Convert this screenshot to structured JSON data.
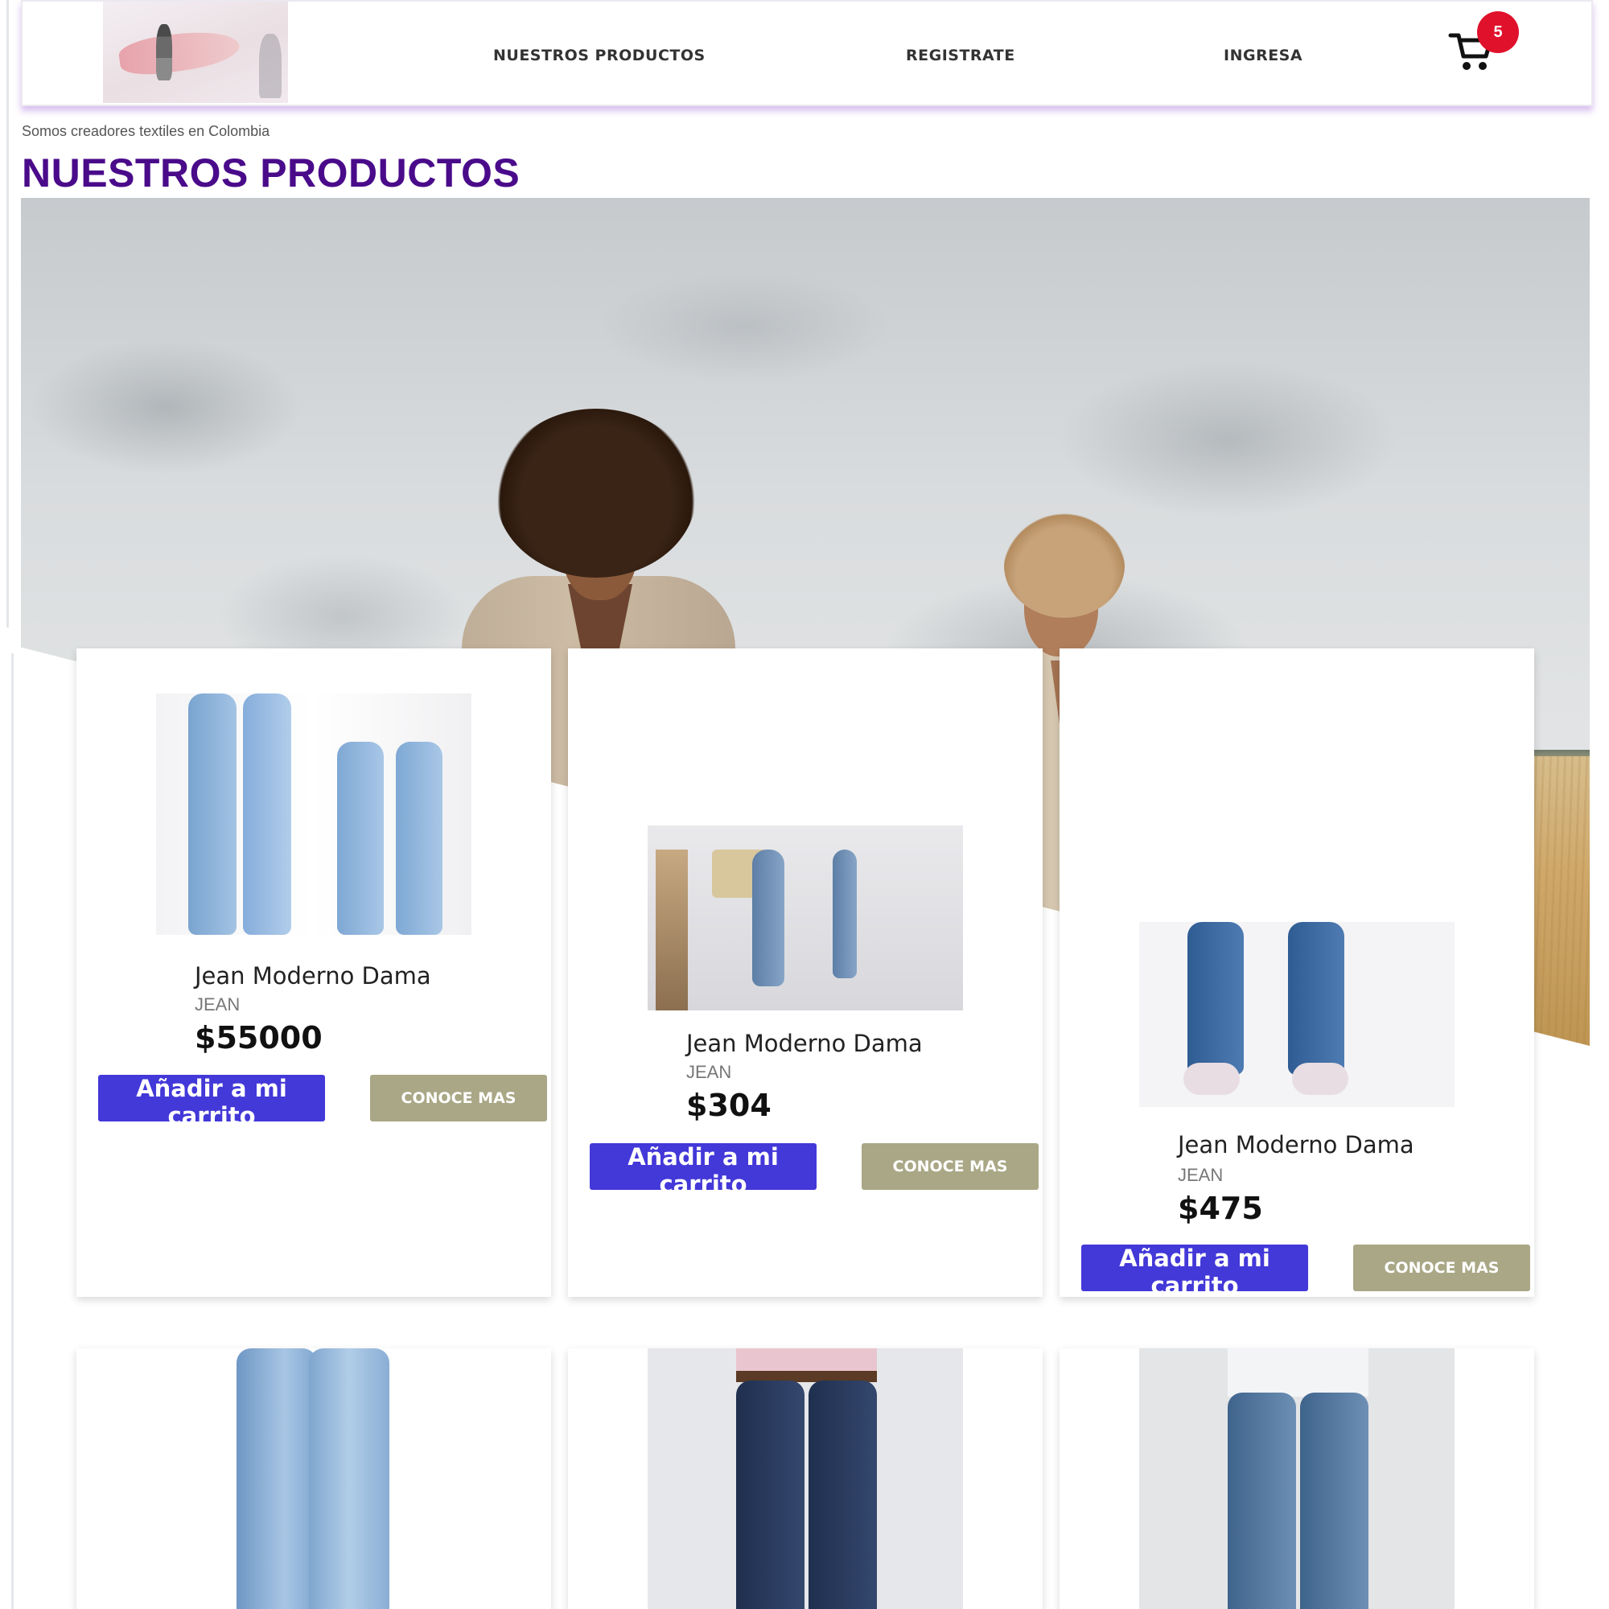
{
  "header": {
    "nav": [
      {
        "label": "NUESTROS PRODUCTOS"
      },
      {
        "label": "REGISTRATE"
      },
      {
        "label": "INGRESA"
      }
    ],
    "cart_count": "5",
    "logo_icon": "mannequin-logo"
  },
  "intro": {
    "tagline": "Somos creadores textiles en Colombia",
    "title": "NUESTROS PRODUCTOS"
  },
  "products": [
    {
      "name": "Jean Moderno Dama",
      "category": "JEAN",
      "price": "$55000",
      "add_label": "Añadir a mi carrito",
      "more_label": "CONOCE MAS"
    },
    {
      "name": "Jean Moderno Dama",
      "category": "JEAN",
      "price": "$304",
      "add_label": "Añadir a mi carrito",
      "more_label": "CONOCE MAS"
    },
    {
      "name": "Jean Moderno Dama",
      "category": "JEAN",
      "price": "$475",
      "add_label": "Añadir a mi carrito",
      "more_label": "CONOCE MAS"
    }
  ],
  "colors": {
    "title": "#4a0b8a",
    "primary_button": "#4338d8",
    "secondary_button": "#a9a785",
    "badge": "#e0112b",
    "nav_shadow": "#b57ee0"
  },
  "icons": [
    "cart-icon",
    "mannequin-logo"
  ]
}
